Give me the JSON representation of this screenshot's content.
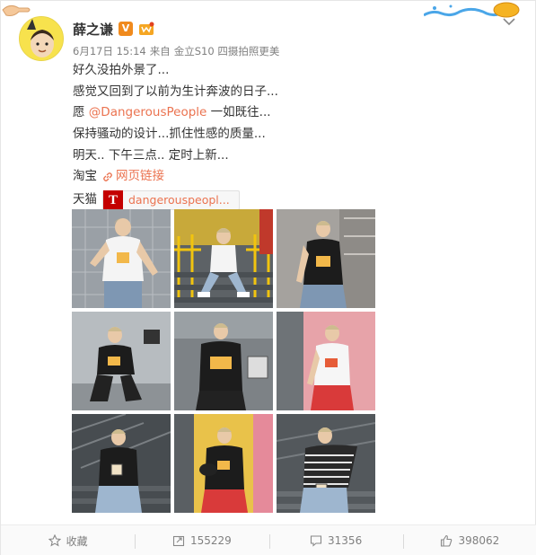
{
  "post": {
    "author": "薛之谦",
    "vip_badge": "V",
    "meta": {
      "date": "6月17日 15:14",
      "source_prefix": "来自",
      "device": "金立S10 四摄拍照更美"
    },
    "lines": [
      "好久没拍外景了...",
      "感觉又回到了以前为生计奔波的日子..."
    ],
    "mention_line": {
      "prefix": "愿 ",
      "mention": "@DangerousPeople",
      "suffix": " 一如既往..."
    },
    "lines_after": [
      "保持骚动的设计...抓住性感的质量...",
      "明天.. 下午三点.. 定时上新..."
    ],
    "taobao": {
      "label": "淘宝",
      "link_text": "网页链接"
    },
    "tmall": {
      "label": "天猫",
      "logo_letter": "T",
      "card_text": "dangerouspeopl..."
    }
  },
  "photos": [
    {
      "name": "photo-1",
      "scene": "metal wall, white tee"
    },
    {
      "name": "photo-2",
      "scene": "yellow stairs, sitting"
    },
    {
      "name": "photo-3",
      "scene": "concrete wall, black tee"
    },
    {
      "name": "photo-4",
      "scene": "grey wall, crouching black tee"
    },
    {
      "name": "photo-5",
      "scene": "black tee with sign"
    },
    {
      "name": "photo-6",
      "scene": "pink wall, white tee"
    },
    {
      "name": "photo-7",
      "scene": "stairs, holding cup"
    },
    {
      "name": "photo-8",
      "scene": "yellow wall, holding hat"
    },
    {
      "name": "photo-9",
      "scene": "stairs, striped shirt"
    }
  ],
  "actions": {
    "favorite": "收藏",
    "repost": "155229",
    "comment": "31356",
    "like": "398062"
  },
  "colors": {
    "accent": "#eb7350",
    "vip": "#f08a1d",
    "tmall": "#c40000"
  }
}
